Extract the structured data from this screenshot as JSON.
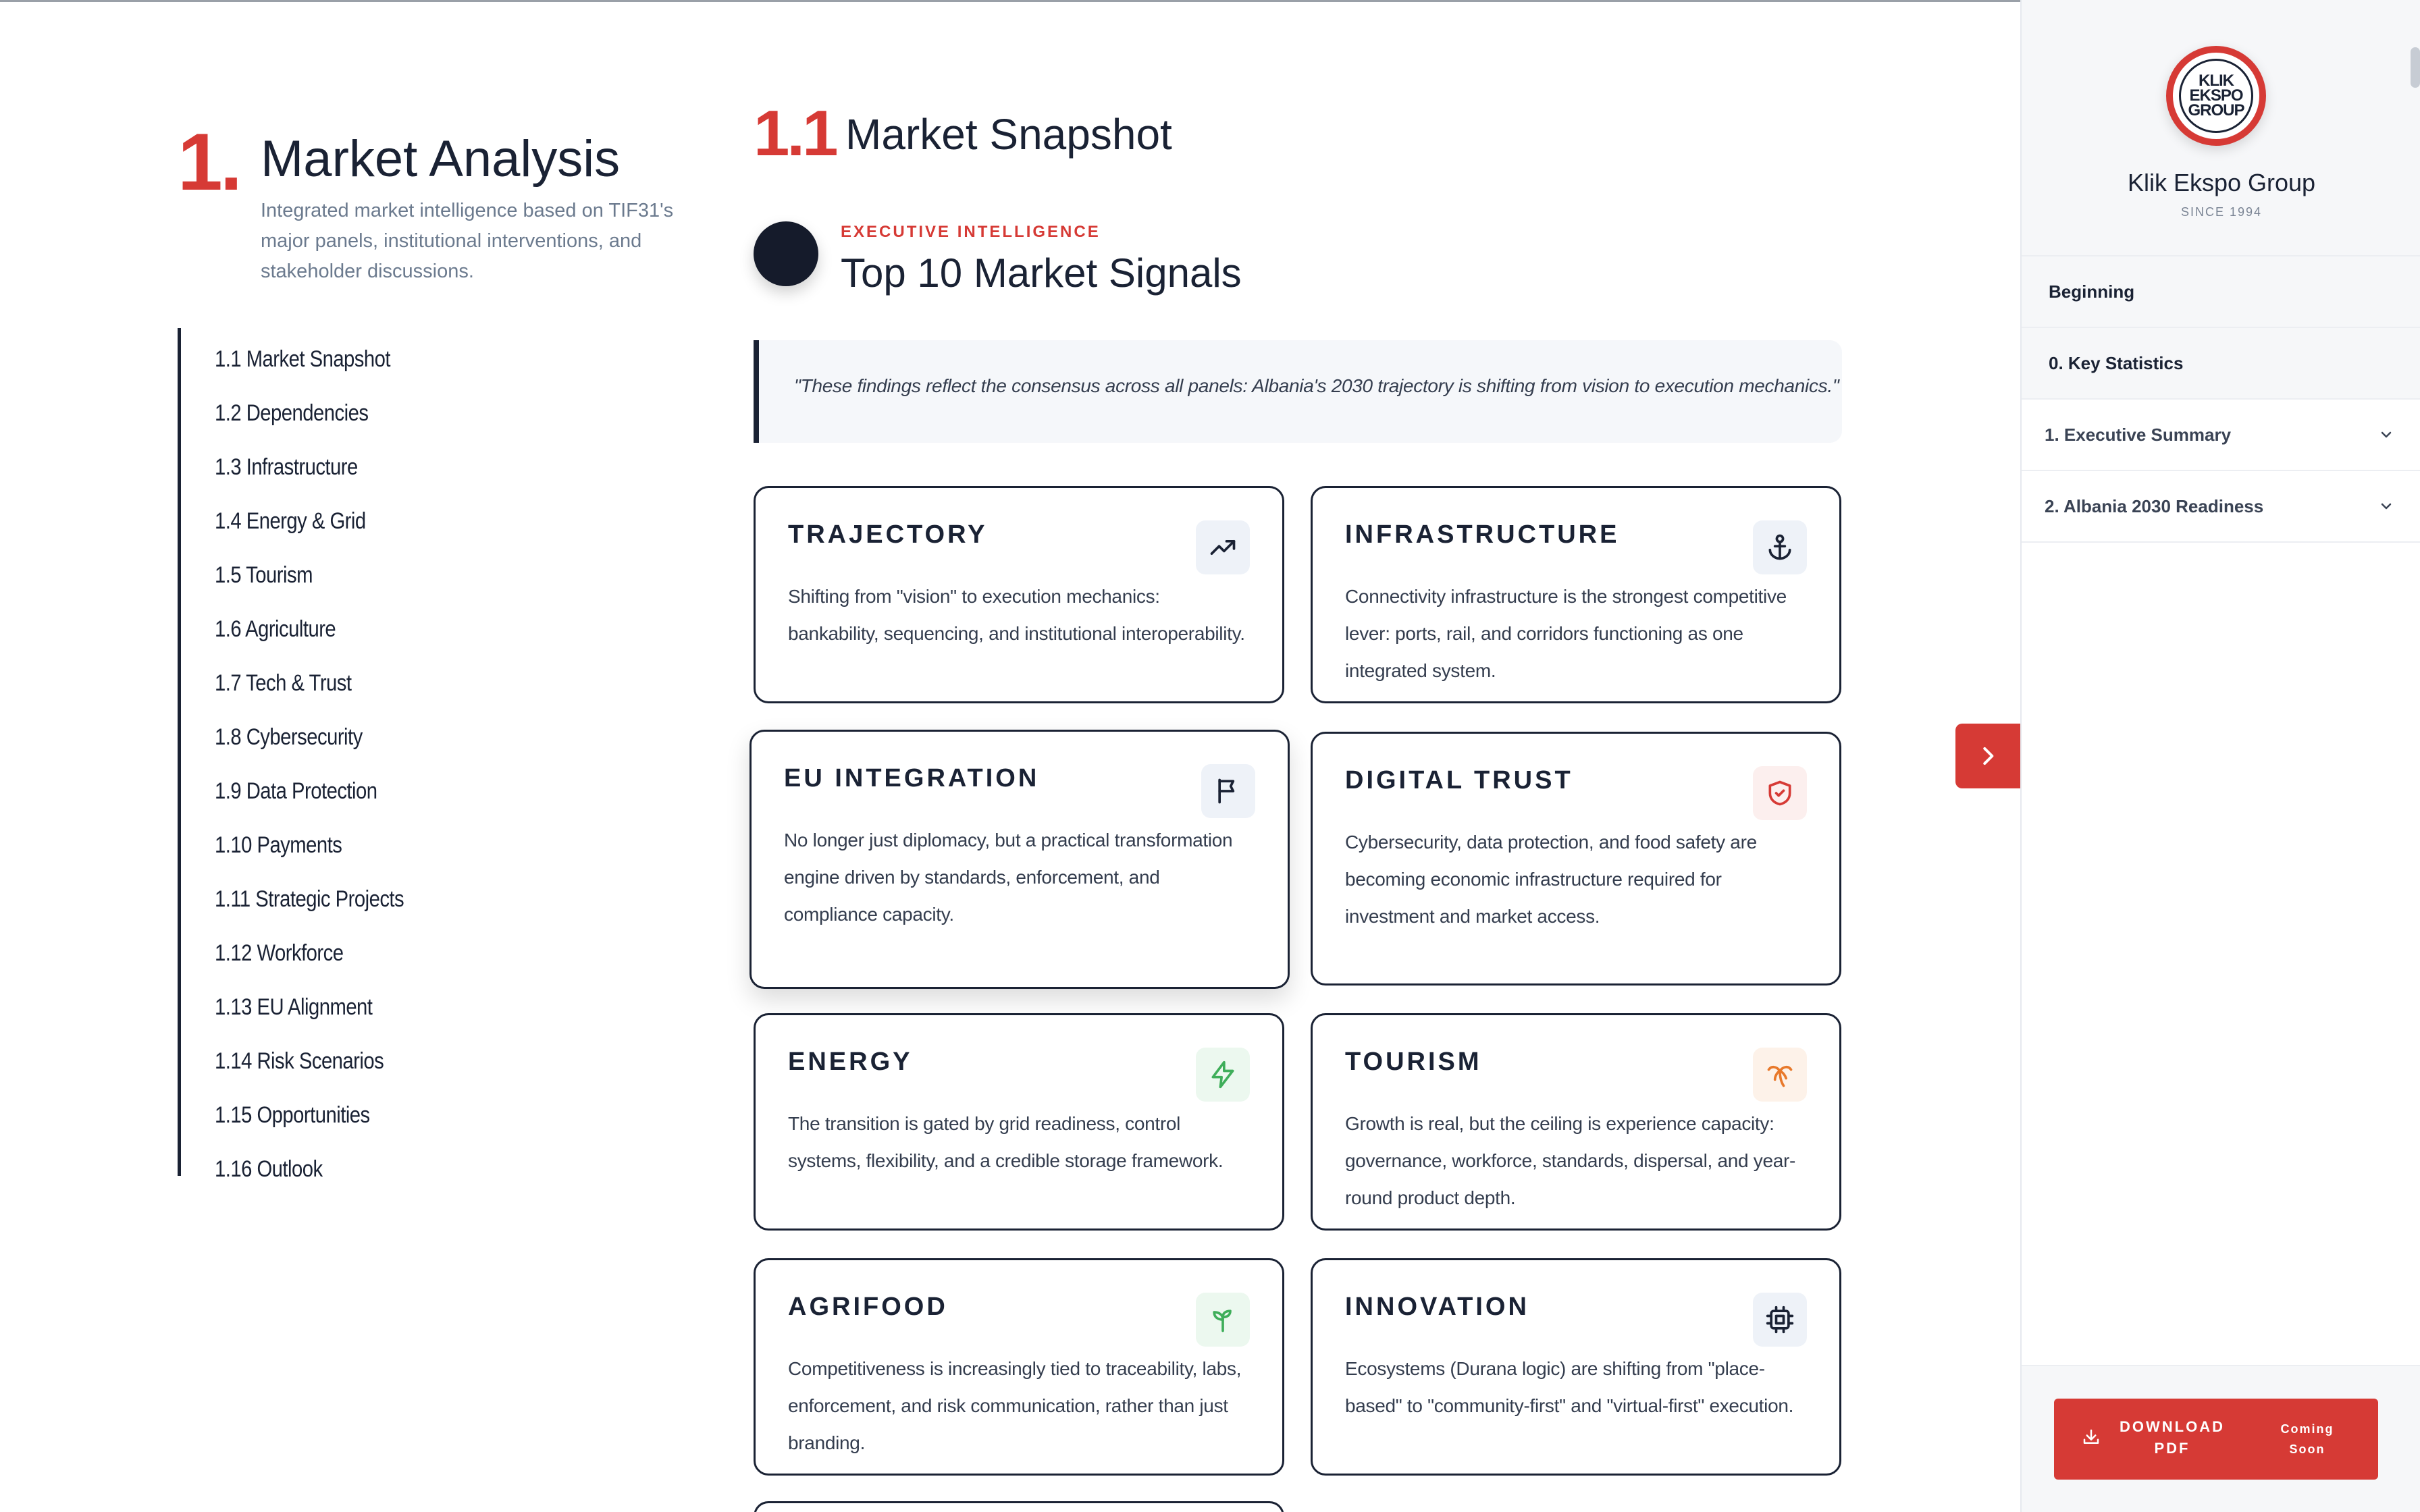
{
  "section": {
    "number": "1.",
    "title": "Market Analysis",
    "description": "Integrated market intelligence based on TIF31's major panels, institutional interventions, and stakeholder discussions."
  },
  "toc": {
    "items": [
      "1.1 Market Snapshot",
      "1.2 Dependencies",
      "1.3 Infrastructure",
      "1.4 Energy & Grid",
      "1.5 Tourism",
      "1.6 Agriculture",
      "1.7 Tech & Trust",
      "1.8 Cybersecurity",
      "1.9 Data Protection",
      "1.10 Payments",
      "1.11 Strategic Projects",
      "1.12 Workforce",
      "1.13 EU Alignment",
      "1.14 Risk Scenarios",
      "1.15 Opportunities",
      "1.16 Outlook"
    ]
  },
  "main": {
    "subsection_number": "1.1",
    "subsection_title": "Market Snapshot",
    "eyebrow": "EXECUTIVE INTELLIGENCE",
    "block_title": "Top 10 Market Signals",
    "quote": "\"These findings reflect the consensus across all panels: Albania's 2030 trajectory is shifting from vision to execution mechanics.\"",
    "cards": [
      {
        "title": "TRAJECTORY",
        "body": "Shifting from \"vision\" to execution mechanics: bankability, sequencing, and institutional interoperability.",
        "icon": "trending-up-icon",
        "icon_color": "#1a2234",
        "icon_bg": "#eef2f8"
      },
      {
        "title": "INFRASTRUCTURE",
        "body": "Connectivity infrastructure is the strongest competitive lever: ports, rail, and corridors functioning as one integrated system.",
        "icon": "anchor-icon",
        "icon_color": "#1a2234",
        "icon_bg": "#eef2f8"
      },
      {
        "title": "EU INTEGRATION",
        "body": "No longer just diplomacy, but a practical transformation engine driven by standards, enforcement, and compliance capacity.",
        "icon": "flag-icon",
        "icon_color": "#1a2234",
        "icon_bg": "#eef2f8"
      },
      {
        "title": "DIGITAL TRUST",
        "body": "Cybersecurity, data protection, and food safety are becoming economic infrastructure required for investment and market access.",
        "icon": "shield-check-icon",
        "icon_color": "#d63a35",
        "icon_bg": "#fcefee"
      },
      {
        "title": "ENERGY",
        "body": "The transition is gated by grid readiness, control systems, flexibility, and a credible storage framework.",
        "icon": "lightning-icon",
        "icon_color": "#3fae5a",
        "icon_bg": "#ecf8ef"
      },
      {
        "title": "TOURISM",
        "body": "Growth is real, but the ceiling is experience capacity: governance, workforce, standards, dispersal, and year-round product depth.",
        "icon": "palm-tree-icon",
        "icon_color": "#e8792b",
        "icon_bg": "#fdf2e9"
      },
      {
        "title": "AGRIFOOD",
        "body": "Competitiveness is increasingly tied to traceability, labs, enforcement, and risk communication, rather than just branding.",
        "icon": "sprout-icon",
        "icon_color": "#3fae5a",
        "icon_bg": "#ecf8ef"
      },
      {
        "title": "INNOVATION",
        "body": "Ecosystems (Durana logic) are shifting from \"place-based\" to \"community-first\" and \"virtual-first\" execution.",
        "icon": "cpu-chip-icon",
        "icon_color": "#1a2234",
        "icon_bg": "#eef2f8"
      }
    ]
  },
  "panel": {
    "logo_text": "KLIK EKSPO GROUP",
    "brand_name": "Klik Ekspo Group",
    "since": "SINCE 1994",
    "nav": [
      {
        "label": "Beginning"
      },
      {
        "label": "0. Key Statistics"
      },
      {
        "label": "1. Executive Summary"
      },
      {
        "label": "2. Albania 2030 Readiness"
      }
    ],
    "download_label": "DOWNLOAD PDF",
    "coming_soon": "Coming Soon"
  },
  "colors": {
    "accent": "#d63a35",
    "ink": "#1a2234"
  }
}
